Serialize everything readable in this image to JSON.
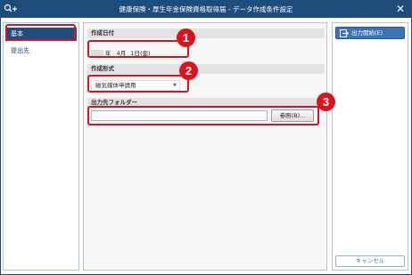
{
  "window": {
    "title": "健康保険・厚生年金保険資格取得届 - データ作成条件設定"
  },
  "sidebar": {
    "items": [
      {
        "label": "基本"
      },
      {
        "label": "提出先"
      }
    ]
  },
  "sections": {
    "date": {
      "label": "作成日付",
      "year_suffix": "年",
      "month": "4月",
      "day": "1日",
      "weekday": "(金)"
    },
    "format": {
      "label": "作成形式",
      "selected": "磁気媒体申請用"
    },
    "folder": {
      "label": "出力先フォルダー",
      "value": "",
      "browse_label": "参照(B)..."
    }
  },
  "actions": {
    "start_label": "出力開始(E)",
    "cancel_label": "キャンセル"
  },
  "callouts": [
    "1",
    "2",
    "3"
  ],
  "colors": {
    "titlebar": "#1f4d7b",
    "highlight": "#d3151f",
    "primary_button": "#3c73b6"
  }
}
